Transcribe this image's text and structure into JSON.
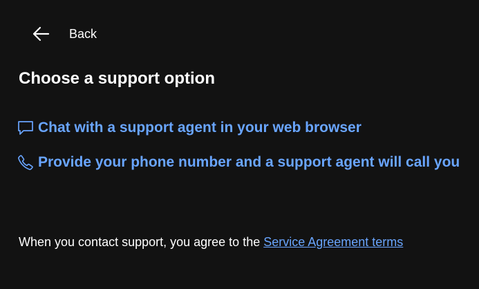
{
  "nav": {
    "back_label": "Back",
    "back_icon": "arrow-left-icon"
  },
  "page": {
    "title": "Choose a support option"
  },
  "options": [
    {
      "icon": "chat-bubble-icon",
      "label": "Chat with a support agent in your web browser"
    },
    {
      "icon": "phone-icon",
      "label": "Provide your phone number and a support agent will call you"
    }
  ],
  "footer": {
    "text": "When you contact support, you agree to the ",
    "link_label": "Service Agreement terms"
  },
  "colors": {
    "background": "#121212",
    "text": "#ffffff",
    "link": "#69a5ff"
  }
}
